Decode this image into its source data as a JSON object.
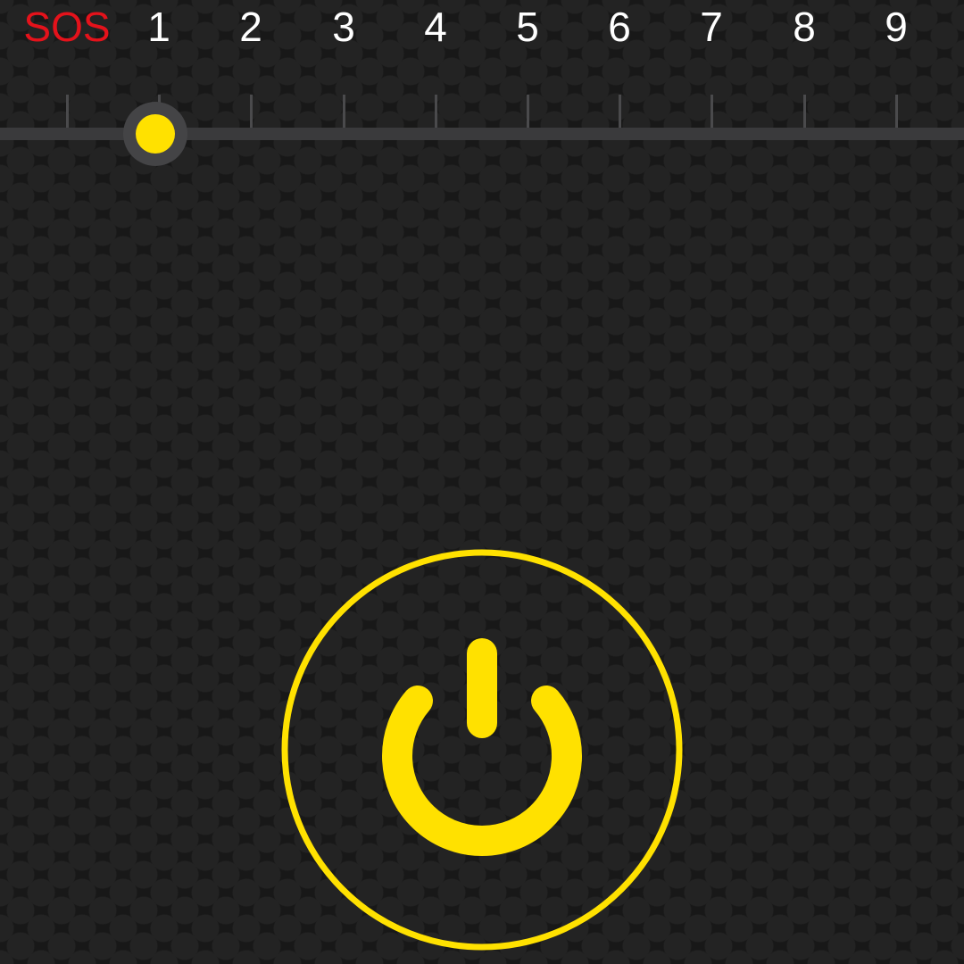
{
  "app": {
    "theme": {
      "background": "#181818",
      "accent": "#ffe100",
      "sos_color": "#e4121b",
      "label_color": "#ffffff",
      "track_color": "#3a3a3c"
    }
  },
  "strobe_scale": {
    "labels": [
      "SOS",
      "1",
      "2",
      "3",
      "4",
      "5",
      "6",
      "7",
      "8",
      "9"
    ],
    "selected_index": 1,
    "selected_label": "1"
  },
  "power_button": {
    "icon": "power-icon",
    "state": "off"
  }
}
